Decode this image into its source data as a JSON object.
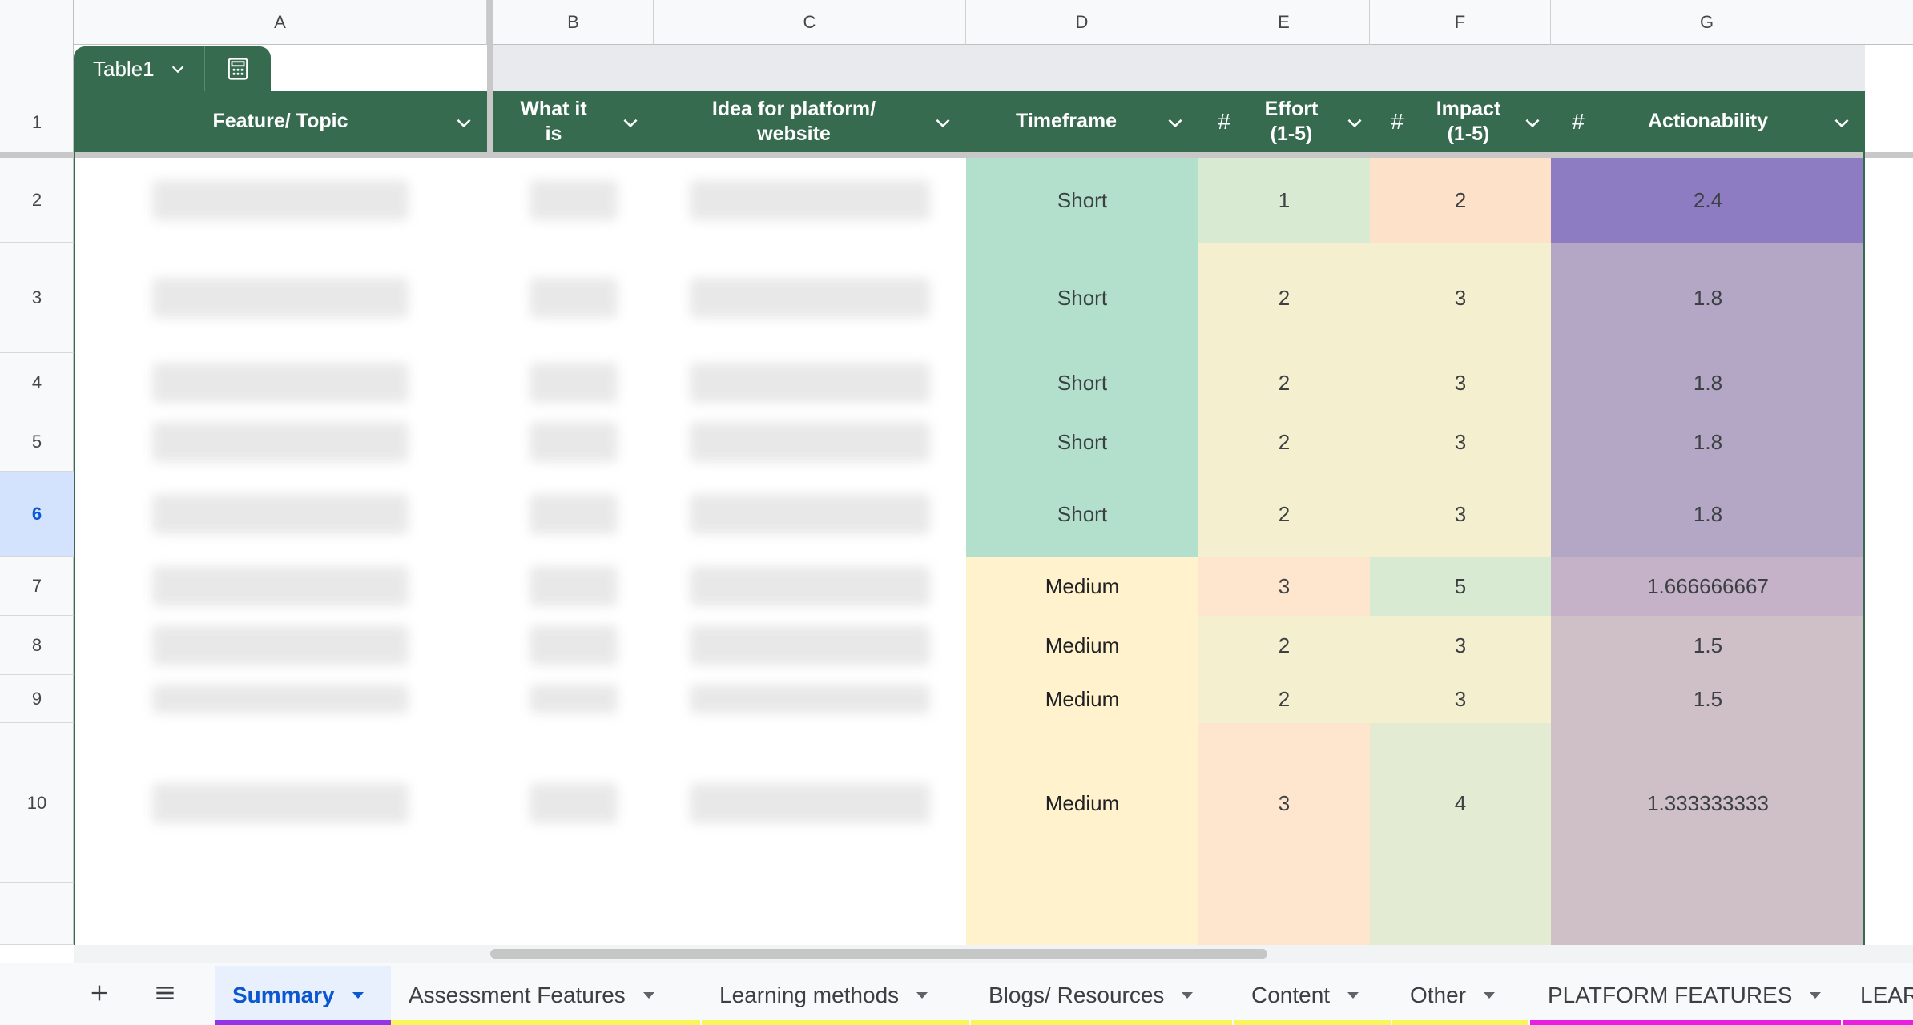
{
  "column_letters": [
    "A",
    "B",
    "C",
    "D",
    "E",
    "F",
    "G"
  ],
  "row_numbers": [
    "1",
    "2",
    "3",
    "4",
    "5",
    "6",
    "7",
    "8",
    "9",
    "10",
    ""
  ],
  "selected_row": "6",
  "table": {
    "name": "Table1",
    "headers": {
      "a": "Feature/ Topic",
      "b": "What it is",
      "c": "Idea for platform/ website",
      "d": "Timeframe",
      "e": "Effort (1-5)",
      "f": "Impact (1-5)",
      "g": "Actionability"
    },
    "number_type_symbol": "#",
    "rows": [
      {
        "timeframe": "Short",
        "effort": "1",
        "impact": "2",
        "actionability": "2.4"
      },
      {
        "timeframe": "Short",
        "effort": "2",
        "impact": "3",
        "actionability": "1.8"
      },
      {
        "timeframe": "Short",
        "effort": "2",
        "impact": "3",
        "actionability": "1.8"
      },
      {
        "timeframe": "Short",
        "effort": "2",
        "impact": "3",
        "actionability": "1.8"
      },
      {
        "timeframe": "Short",
        "effort": "2",
        "impact": "3",
        "actionability": "1.8"
      },
      {
        "timeframe": "Medium",
        "effort": "3",
        "impact": "5",
        "actionability": "1.666666667"
      },
      {
        "timeframe": "Medium",
        "effort": "2",
        "impact": "3",
        "actionability": "1.5"
      },
      {
        "timeframe": "Medium",
        "effort": "2",
        "impact": "3",
        "actionability": "1.5"
      },
      {
        "timeframe": "Medium",
        "effort": "3",
        "impact": "4",
        "actionability": "1.333333333"
      }
    ]
  },
  "colors": {
    "table_header_green": "#366b4f",
    "short_green": "#b3e0cc",
    "medium_yellow": "#fff2cc",
    "effort_green": "#d9ead3",
    "effort_peach": "#fde6cd",
    "effort_cream": "#f3efcf",
    "impact_peach": "#fde1c9",
    "impact_cream": "#f3efcf",
    "impact_green": "#d9ead3",
    "impact_sage": "#e3ebd2",
    "action_dark_purple": "#8e7cc3",
    "action_purple": "#b4a7c5",
    "action_mauve": "#c5b2c8",
    "action_pink": "#cfc0c8",
    "active_tab": "#0b57d0"
  },
  "sheet_tabs": [
    {
      "label": "Summary",
      "underline": "#9334e6"
    },
    {
      "label": "Assessment Features",
      "underline": "#f8f65a"
    },
    {
      "label": "Learning methods",
      "underline": "#f8f65a"
    },
    {
      "label": "Blogs/ Resources",
      "underline": "#f8f65a"
    },
    {
      "label": "Content",
      "underline": "#f8f65a"
    },
    {
      "label": "Other",
      "underline": "#f8f65a"
    },
    {
      "label": "PLATFORM FEATURES",
      "underline": "#e81fe0"
    },
    {
      "label": "LEAR",
      "underline": "#e81fe0"
    }
  ],
  "icons": {
    "add_sheet": "plus-icon",
    "all_sheets": "menu-icon",
    "table_menu": "chevron-down-icon",
    "table_calc": "calculator-icon"
  }
}
